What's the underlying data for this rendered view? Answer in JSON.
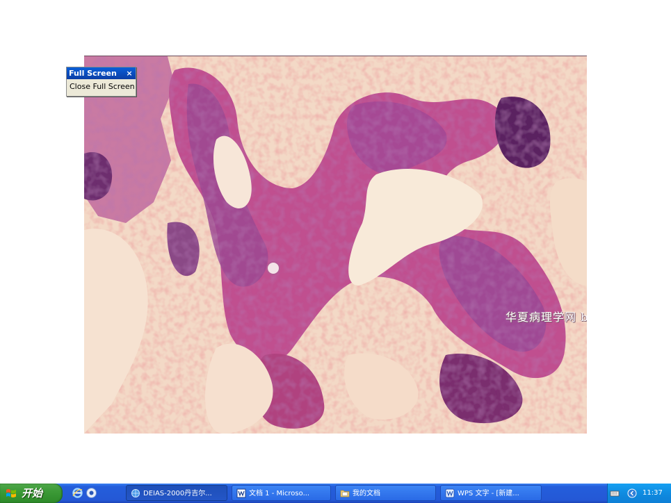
{
  "fullscreen_toolbar": {
    "title": "Full Screen",
    "close_glyph": "×",
    "close_button_label": "Close Full Screen"
  },
  "slide": {
    "watermark": "华夏病理学网 by hyfhql",
    "image_icon": "histology-micrograph"
  },
  "taskbar": {
    "start_label": "开始",
    "quick_launch": [
      "ie-icon",
      "media-icon"
    ],
    "tasks": [
      {
        "label": "DEIAS-2000丹吉尔...",
        "icon": "ie-globe-icon"
      },
      {
        "label": "文档 1 - Microso...",
        "icon": "word-icon"
      },
      {
        "label": "我的文档",
        "icon": "folder-icon"
      },
      {
        "label": "WPS 文字 - [新建...",
        "icon": "wps-icon"
      }
    ],
    "clock": "11:37",
    "colors": {
      "taskbar": "#245edb",
      "start": "#3c9a37",
      "tray": "#0f8be0"
    }
  }
}
